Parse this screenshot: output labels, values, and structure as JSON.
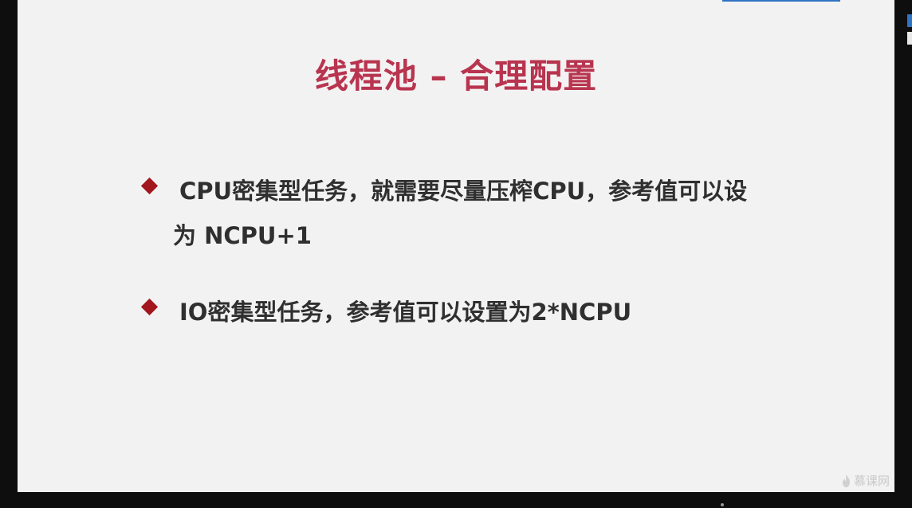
{
  "slide": {
    "title": "线程池 – 合理配置",
    "bullets": [
      {
        "line1": "CPU密集型任务，就需要尽量压榨CPU，参考值可以设",
        "line2": "为 NCPU+1"
      },
      {
        "line1": "IO密集型任务，参考值可以设置为2*NCPU"
      }
    ],
    "watermark": "慕课网"
  },
  "colors": {
    "title": "#b8344f",
    "bullet_marker": "#a2161e",
    "text": "#2f2f2f",
    "slide_bg": "#f3f2f2",
    "accent": "#2f73c4"
  },
  "icons": {
    "bullet": "diamond-icon",
    "watermark_logo": "flame-icon"
  }
}
